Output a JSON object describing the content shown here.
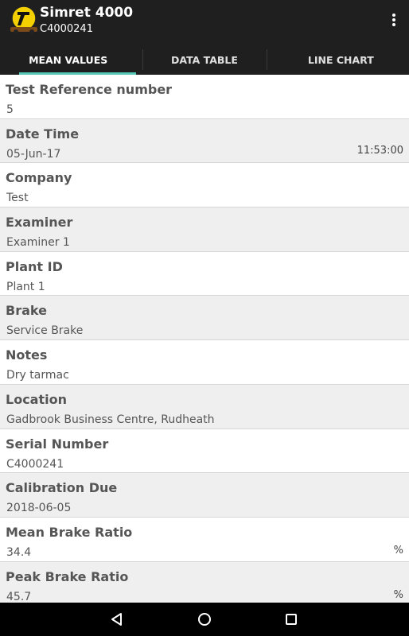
{
  "app": {
    "title": "Simret 4000",
    "subtitle": "C4000241",
    "logo_icon": "simret-logo-icon",
    "overflow_icon": "more-vert-icon"
  },
  "tabs": [
    {
      "label": "MEAN VALUES",
      "active": true
    },
    {
      "label": "DATA TABLE",
      "active": false
    },
    {
      "label": "LINE CHART",
      "active": false
    }
  ],
  "rows": [
    {
      "label": "Test Reference number",
      "value": "5",
      "extra": ""
    },
    {
      "label": "Date Time",
      "value": "05-Jun-17",
      "extra": "11:53:00"
    },
    {
      "label": "Company",
      "value": "Test",
      "extra": ""
    },
    {
      "label": "Examiner",
      "value": "Examiner 1",
      "extra": ""
    },
    {
      "label": "Plant ID",
      "value": "Plant 1",
      "extra": ""
    },
    {
      "label": "Brake",
      "value": "Service Brake",
      "extra": ""
    },
    {
      "label": "Notes",
      "value": "Dry tarmac",
      "extra": ""
    },
    {
      "label": "Location",
      "value": "Gadbrook Business Centre, Rudheath",
      "extra": ""
    },
    {
      "label": "Serial Number",
      "value": "C4000241",
      "extra": ""
    },
    {
      "label": "Calibration Due",
      "value": "2018-06-05",
      "extra": ""
    },
    {
      "label": "Mean Brake Ratio",
      "value": "34.4",
      "extra": "%"
    },
    {
      "label": "Peak Brake Ratio",
      "value": "45.7",
      "extra": "%"
    }
  ],
  "nav": {
    "back_icon": "back-icon",
    "home_icon": "home-icon",
    "recents_icon": "recents-icon"
  },
  "colors": {
    "appbar": "#1f1f1f",
    "tab_indicator": "#58c9b9",
    "row_alt": "#efefef",
    "logo_yellow": "#f4d000"
  }
}
